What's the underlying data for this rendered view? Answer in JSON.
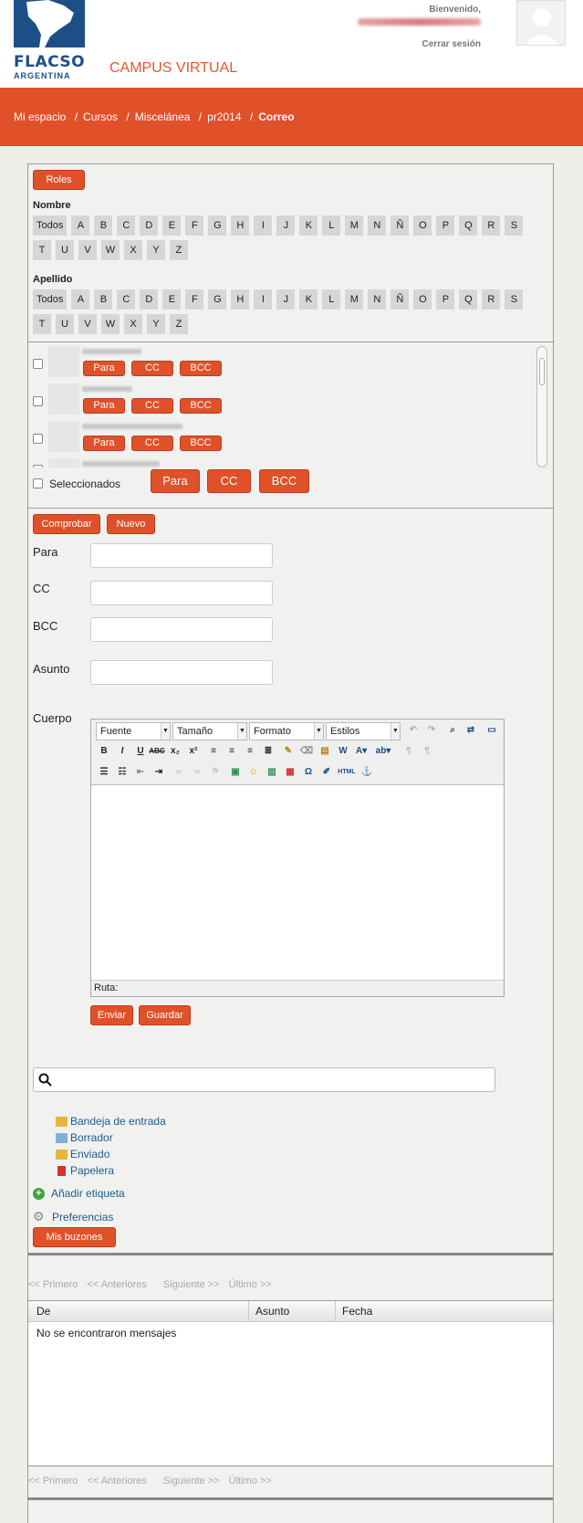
{
  "header": {
    "logo_line1": "FLACSO",
    "logo_line2": "ARGENTINA",
    "campus": "CAMPUS VIRTUAL",
    "welcome": "Bienvenido,",
    "logout": "Cerrar sesión"
  },
  "breadcrumb": [
    "Mi espacio",
    "Cursos",
    "Miscelánea",
    "pr2014",
    "Correo"
  ],
  "roles_button": "Roles",
  "name_filter": {
    "label": "Nombre",
    "letters": [
      "Todos",
      "A",
      "B",
      "C",
      "D",
      "E",
      "F",
      "G",
      "H",
      "I",
      "J",
      "K",
      "L",
      "M",
      "N",
      "Ñ",
      "O",
      "P",
      "Q",
      "R",
      "S",
      "T",
      "U",
      "V",
      "W",
      "X",
      "Y",
      "Z"
    ]
  },
  "surname_filter": {
    "label": "Apellido",
    "letters": [
      "Todos",
      "A",
      "B",
      "C",
      "D",
      "E",
      "F",
      "G",
      "H",
      "I",
      "J",
      "K",
      "L",
      "M",
      "N",
      "Ñ",
      "O",
      "P",
      "Q",
      "R",
      "S",
      "T",
      "U",
      "V",
      "W",
      "X",
      "Y",
      "Z"
    ]
  },
  "contact_buttons": {
    "to": "Para",
    "cc": "CC",
    "bcc": "BCC"
  },
  "selected": {
    "label": "Seleccionados",
    "to": "Para",
    "cc": "CC",
    "bcc": "BCC"
  },
  "compose": {
    "check_button": "Comprobar",
    "new_button": "Nuevo",
    "to_label": "Para",
    "cc_label": "CC",
    "bcc_label": "BCC",
    "subject_label": "Asunto",
    "body_label": "Cuerpo",
    "font_combo": "Fuente",
    "size_combo": "Tamaño",
    "format_combo": "Formato",
    "styles_combo": "Estilos",
    "path_label": "Ruta:",
    "send_button": "Enviar",
    "save_button": "Guardar"
  },
  "folders": [
    {
      "label": "Bandeja de entrada",
      "color": "#e8b53a"
    },
    {
      "label": "Borrador",
      "color": "#7fb0d8"
    },
    {
      "label": "Enviado",
      "color": "#e8b53a"
    },
    {
      "label": "Papelera",
      "color": "#d43030"
    }
  ],
  "add_tag": "Añadir etiqueta",
  "preferences": "Preferencias",
  "mailboxes_button": "Mis buzones",
  "pager": {
    "first": "<< Primero",
    "prev": "<< Anteriores",
    "next": "Siguiente >>",
    "last": "Último >>"
  },
  "table": {
    "columns": [
      "De",
      "Asunto",
      "Fecha"
    ],
    "empty_message": "No se encontraron mensajes"
  },
  "colors": {
    "brand_orange": "#e0512a",
    "brand_blue": "#1d4f86",
    "link_blue": "#1f5b8c"
  }
}
